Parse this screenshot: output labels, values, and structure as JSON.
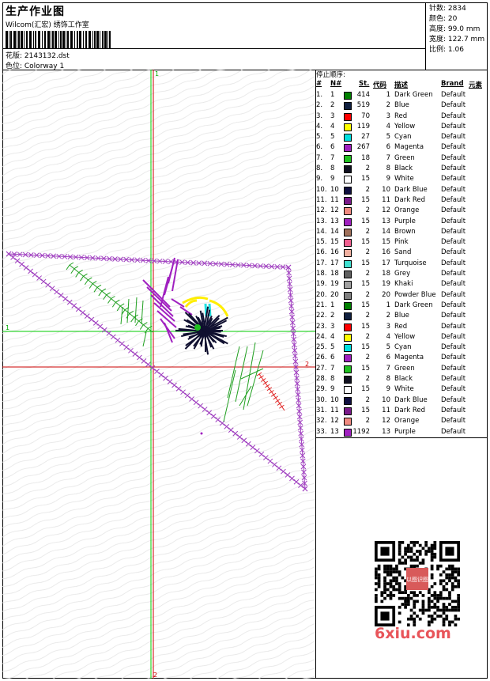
{
  "header": {
    "title": "生产作业图",
    "company": "Wilcom(汇宏) 绣饰工作室",
    "pattern": "花版: 2143132.dst",
    "colorway": "色位: Colorway 1"
  },
  "stats": [
    {
      "label": "针数:",
      "value": "2834"
    },
    {
      "label": "颜色:",
      "value": "20"
    },
    {
      "label": "高度:",
      "value": "99.0 mm"
    },
    {
      "label": "宽度:",
      "value": "122.7 mm"
    },
    {
      "label": "比例:",
      "value": "1.06"
    }
  ],
  "canvas": {
    "marker_v_top": "1",
    "marker_v_bottom": "2",
    "marker_h_left": "1",
    "marker_h_right": "2"
  },
  "stop_sequence": {
    "title": "停止顺序:",
    "headers": {
      "idx": "#",
      "n": "N#",
      "st": "St.",
      "code": "代码",
      "desc": "描述",
      "brand": "Brand",
      "elem": "元素"
    },
    "rows": [
      {
        "idx": "1.",
        "n": "1",
        "color": "#008000",
        "st": "414",
        "code": "1",
        "desc": "Dark Green",
        "brand": "Default"
      },
      {
        "idx": "2.",
        "n": "2",
        "color": "#102040",
        "st": "519",
        "code": "2",
        "desc": "Blue",
        "brand": "Default"
      },
      {
        "idx": "3.",
        "n": "3",
        "color": "#ff0000",
        "st": "70",
        "code": "3",
        "desc": "Red",
        "brand": "Default"
      },
      {
        "idx": "4.",
        "n": "4",
        "color": "#ffff00",
        "st": "119",
        "code": "4",
        "desc": "Yellow",
        "brand": "Default"
      },
      {
        "idx": "5.",
        "n": "5",
        "color": "#00e0e0",
        "st": "27",
        "code": "5",
        "desc": "Cyan",
        "brand": "Default"
      },
      {
        "idx": "6.",
        "n": "6",
        "color": "#a020c0",
        "st": "267",
        "code": "6",
        "desc": "Magenta",
        "brand": "Default"
      },
      {
        "idx": "7.",
        "n": "7",
        "color": "#20c020",
        "st": "18",
        "code": "7",
        "desc": "Green",
        "brand": "Default"
      },
      {
        "idx": "8.",
        "n": "8",
        "color": "#101020",
        "st": "2",
        "code": "8",
        "desc": "Black",
        "brand": "Default"
      },
      {
        "idx": "9.",
        "n": "9",
        "color": "#ffffff",
        "st": "15",
        "code": "9",
        "desc": "White",
        "brand": "Default"
      },
      {
        "idx": "10.",
        "n": "10",
        "color": "#101040",
        "st": "2",
        "code": "10",
        "desc": "Dark Blue",
        "brand": "Default"
      },
      {
        "idx": "11.",
        "n": "11",
        "color": "#7a1a8a",
        "st": "15",
        "code": "11",
        "desc": "Dark Red",
        "brand": "Default"
      },
      {
        "idx": "12.",
        "n": "12",
        "color": "#f08a80",
        "st": "2",
        "code": "12",
        "desc": "Orange",
        "brand": "Default"
      },
      {
        "idx": "13.",
        "n": "13",
        "color": "#a020c0",
        "st": "15",
        "code": "13",
        "desc": "Purple",
        "brand": "Default"
      },
      {
        "idx": "14.",
        "n": "14",
        "color": "#a0705a",
        "st": "2",
        "code": "14",
        "desc": "Brown",
        "brand": "Default"
      },
      {
        "idx": "15.",
        "n": "15",
        "color": "#f06090",
        "st": "15",
        "code": "15",
        "desc": "Pink",
        "brand": "Default"
      },
      {
        "idx": "16.",
        "n": "16",
        "color": "#f0b0a0",
        "st": "2",
        "code": "16",
        "desc": "Sand",
        "brand": "Default"
      },
      {
        "idx": "17.",
        "n": "17",
        "color": "#40e0d0",
        "st": "15",
        "code": "17",
        "desc": "Turquoise",
        "brand": "Default"
      },
      {
        "idx": "18.",
        "n": "18",
        "color": "#606060",
        "st": "2",
        "code": "18",
        "desc": "Grey",
        "brand": "Default"
      },
      {
        "idx": "19.",
        "n": "19",
        "color": "#a0a0a0",
        "st": "15",
        "code": "19",
        "desc": "Khaki",
        "brand": "Default"
      },
      {
        "idx": "20.",
        "n": "20",
        "color": "#808080",
        "st": "2",
        "code": "20",
        "desc": "Powder Blue",
        "brand": "Default"
      },
      {
        "idx": "21.",
        "n": "1",
        "color": "#008000",
        "st": "15",
        "code": "1",
        "desc": "Dark Green",
        "brand": "Default"
      },
      {
        "idx": "22.",
        "n": "2",
        "color": "#102040",
        "st": "2",
        "code": "2",
        "desc": "Blue",
        "brand": "Default"
      },
      {
        "idx": "23.",
        "n": "3",
        "color": "#ff0000",
        "st": "15",
        "code": "3",
        "desc": "Red",
        "brand": "Default"
      },
      {
        "idx": "24.",
        "n": "4",
        "color": "#ffff00",
        "st": "2",
        "code": "4",
        "desc": "Yellow",
        "brand": "Default"
      },
      {
        "idx": "25.",
        "n": "5",
        "color": "#00e0e0",
        "st": "15",
        "code": "5",
        "desc": "Cyan",
        "brand": "Default"
      },
      {
        "idx": "26.",
        "n": "6",
        "color": "#a020c0",
        "st": "2",
        "code": "6",
        "desc": "Magenta",
        "brand": "Default"
      },
      {
        "idx": "27.",
        "n": "7",
        "color": "#20c020",
        "st": "15",
        "code": "7",
        "desc": "Green",
        "brand": "Default"
      },
      {
        "idx": "28.",
        "n": "8",
        "color": "#101020",
        "st": "2",
        "code": "8",
        "desc": "Black",
        "brand": "Default"
      },
      {
        "idx": "29.",
        "n": "9",
        "color": "#ffffff",
        "st": "15",
        "code": "9",
        "desc": "White",
        "brand": "Default"
      },
      {
        "idx": "30.",
        "n": "10",
        "color": "#101040",
        "st": "2",
        "code": "10",
        "desc": "Dark Blue",
        "brand": "Default"
      },
      {
        "idx": "31.",
        "n": "11",
        "color": "#7a1a8a",
        "st": "15",
        "code": "11",
        "desc": "Dark Red",
        "brand": "Default"
      },
      {
        "idx": "32.",
        "n": "12",
        "color": "#f08a80",
        "st": "2",
        "code": "12",
        "desc": "Orange",
        "brand": "Default"
      },
      {
        "idx": "33.",
        "n": "13",
        "color": "#a020c0",
        "st": "1192",
        "code": "13",
        "desc": "Purple",
        "brand": "Default"
      }
    ]
  },
  "watermark": {
    "site": "6xiu.com",
    "stamp": "以图识图"
  }
}
